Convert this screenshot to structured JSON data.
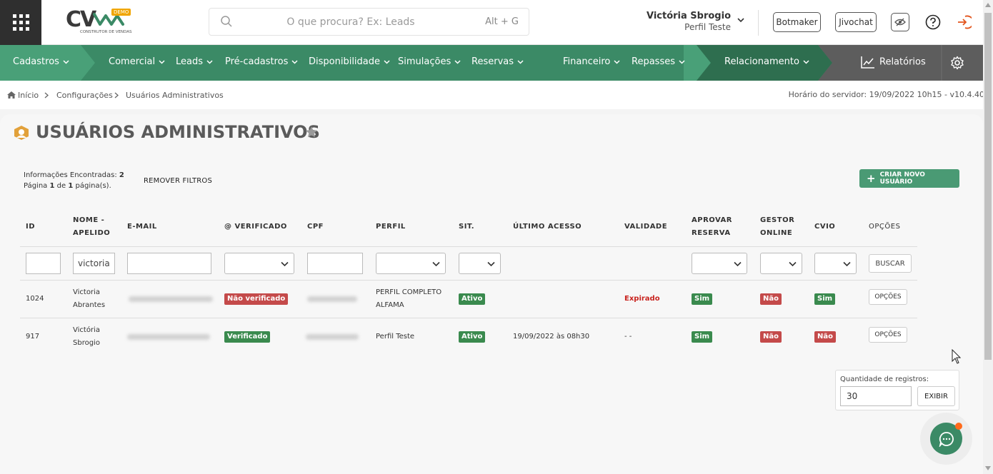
{
  "header": {
    "logo_text": "CV",
    "logo_badge": "DEMO",
    "logo_subtitle": "CONSTRUTOR DE VENDAS",
    "search_placeholder": "O que procura? Ex: Leads",
    "search_shortcut": "Alt + G",
    "user_name": "Victória Sbrogio",
    "user_profile": "Perfil Teste",
    "botmaker_label": "Botmaker",
    "jivochat_label": "Jivochat"
  },
  "nav": {
    "items": [
      {
        "label": "Cadastros"
      },
      {
        "label": "Comercial"
      },
      {
        "label": "Leads"
      },
      {
        "label": "Pré-cadastros"
      },
      {
        "label": "Disponibilidade"
      },
      {
        "label": "Simulações"
      },
      {
        "label": "Reservas"
      },
      {
        "label": "Financeiro"
      },
      {
        "label": "Repasses"
      },
      {
        "label": "Relacionamento"
      }
    ],
    "reports_label": "Relatórios",
    "colors": {
      "main": "#3b8a66",
      "light": "#49a078",
      "dark": "#2e6e4f",
      "gray": "#5d5d5d"
    }
  },
  "breadcrumb": {
    "items": [
      "Início",
      "Configurações",
      "Usuários Administrativos"
    ],
    "server_time": "Horário do servidor: 19/09/2022 10h15 - v10.4.40"
  },
  "page": {
    "title": "USUÁRIOS ADMINISTRATIVOS",
    "info_found_label": "Informações Encontradas:",
    "info_found_count": "2",
    "page_word": "Página",
    "page_current": "1",
    "page_of": "de",
    "page_total": "1",
    "page_suffix": "página(s).",
    "remove_filters": "REMOVER FILTROS",
    "create_button": "CRIAR NOVO USUÁRIO"
  },
  "table": {
    "headers": {
      "id": "ID",
      "name_1": "NOME -",
      "name_2": "APELIDO",
      "email": "E-MAIL",
      "verified": "@ VERIFICADO",
      "cpf": "CPF",
      "profile": "PERFIL",
      "status": "SIT.",
      "last_access": "ÚLTIMO ACESSO",
      "validity": "VALIDADE",
      "approve_1": "APROVAR",
      "approve_2": "RESERVA",
      "manager_1": "GESTOR",
      "manager_2": "ONLINE",
      "cvio": "CVIO",
      "options": "OPÇÕES"
    },
    "filters": {
      "name_value": "victoria",
      "search_button": "BUSCAR"
    },
    "rows": [
      {
        "id": "1024",
        "name_1": "Victoria",
        "name_2": "Abrantes",
        "verified": "Não verificado",
        "profile_1": "PERFIL COMPLETO",
        "profile_2": "ALFAMA",
        "status": "Ativo",
        "last_access": "",
        "validity": "Expirado",
        "approve": "Sim",
        "manager": "Não",
        "cvio": "Sim",
        "options": "OPÇÕES"
      },
      {
        "id": "917",
        "name_1": "Victória",
        "name_2": "Sbrogio",
        "verified": "Verificado",
        "profile_1": "Perfil Teste",
        "profile_2": "",
        "status": "Ativo",
        "last_access": "19/09/2022 às 08h30",
        "validity": "- -",
        "approve": "Sim",
        "manager": "Não",
        "cvio": "Não",
        "options": "OPÇÕES"
      }
    ]
  },
  "pagination": {
    "label": "Quantidade de registros:",
    "value": "30",
    "button": "EXIBIR"
  }
}
